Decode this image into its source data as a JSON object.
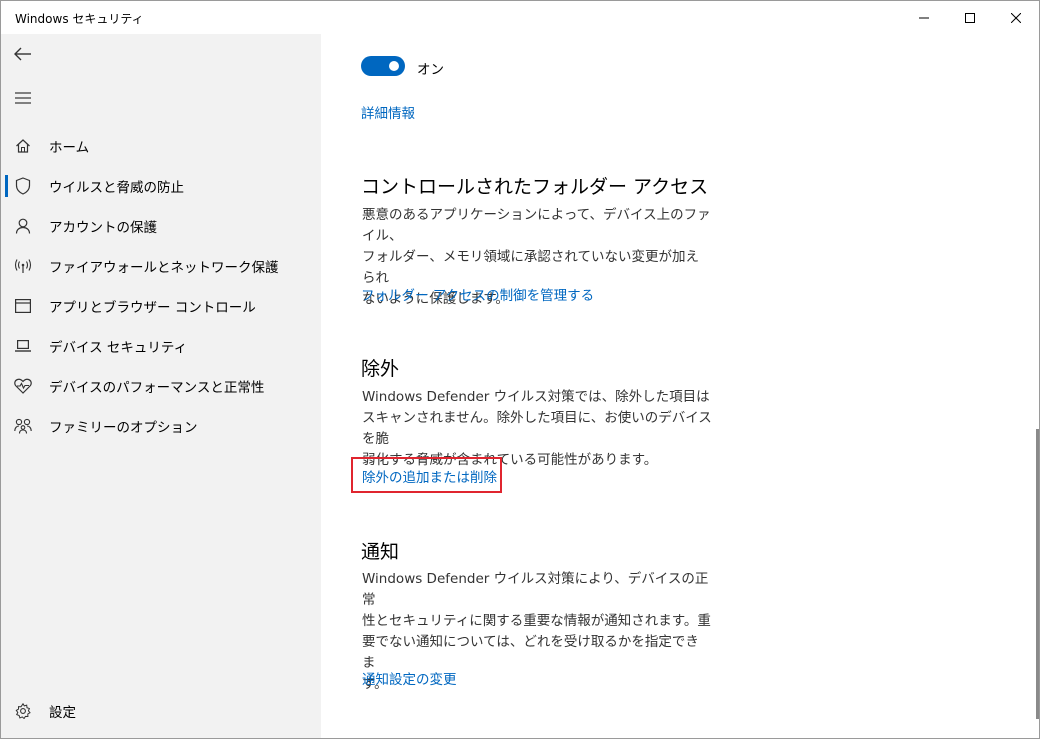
{
  "window": {
    "title": "Windows セキュリティ",
    "controls": [
      "minimize-icon",
      "maximize-icon",
      "close-icon"
    ]
  },
  "sidebar": {
    "back_icon": "back-arrow-icon",
    "menu_icon": "hamburger-menu-icon",
    "items": [
      {
        "label": "ホーム",
        "icon": "home-icon",
        "active": false
      },
      {
        "label": "ウイルスと脅威の防止",
        "icon": "shield-icon",
        "active": true
      },
      {
        "label": "アカウントの保護",
        "icon": "person-icon",
        "active": false
      },
      {
        "label": "ファイアウォールとネットワーク保護",
        "icon": "wireless-icon",
        "active": false
      },
      {
        "label": "アプリとブラウザー コントロール",
        "icon": "app-window-icon",
        "active": false
      },
      {
        "label": "デバイス セキュリティ",
        "icon": "laptop-icon",
        "active": false
      },
      {
        "label": "デバイスのパフォーマンスと正常性",
        "icon": "heart-pulse-icon",
        "active": false
      },
      {
        "label": "ファミリーのオプション",
        "icon": "family-icon",
        "active": false
      }
    ],
    "settings": {
      "label": "設定",
      "icon": "gear-icon"
    }
  },
  "main": {
    "toggle": {
      "state_label": "オン",
      "on": true
    },
    "details_link": "詳細情報",
    "cfa": {
      "heading": "コントロールされたフォルダー アクセス",
      "desc_lines": [
        "悪意のあるアプリケーションによって、デバイス上のファイル、",
        "フォルダー、メモリ領域に承認されていない変更が加えられ",
        "ないように保護します。"
      ],
      "link": "フォルダー アクセスの制御を管理する"
    },
    "exclusions": {
      "heading": "除外",
      "desc_lines": [
        "Windows Defender ウイルス対策では、除外した項目は",
        "スキャンされません。除外した項目に、お使いのデバイスを脆",
        "弱化する脅威が含まれている可能性があります。"
      ],
      "link": "除外の追加または削除"
    },
    "notifications": {
      "heading": "通知",
      "desc_lines": [
        "Windows Defender ウイルス対策により、デバイスの正常",
        "性とセキュリティに関する重要な情報が通知されます。重",
        "要でない通知については、どれを受け取るかを指定できま",
        "す。"
      ],
      "link": "通知設定の変更"
    }
  },
  "colors": {
    "accent": "#0067c0",
    "highlight": "#e0252f",
    "sidebar_bg": "#f2f2f2"
  }
}
